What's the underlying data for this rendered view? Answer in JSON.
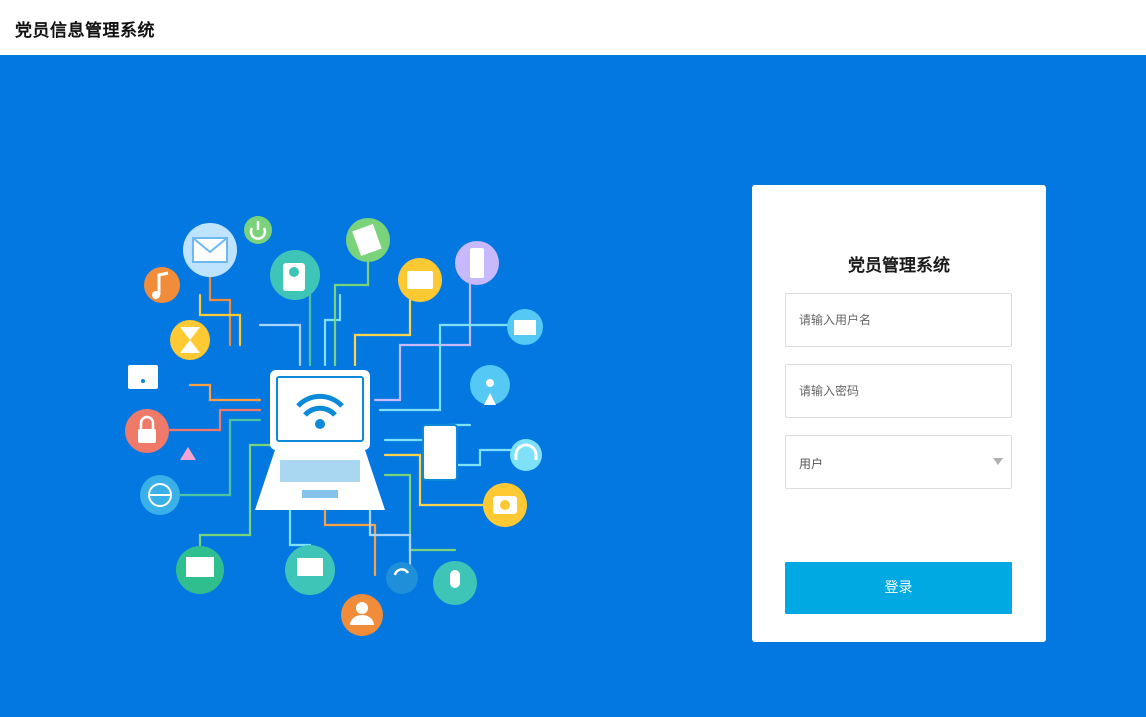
{
  "header": {
    "app_title": "党员信息管理系统"
  },
  "login": {
    "title": "党员管理系统",
    "username": {
      "placeholder": "请输入用户名",
      "value": ""
    },
    "password": {
      "placeholder": "请输入密码",
      "value": ""
    },
    "role": {
      "selected": "用户"
    },
    "submit_label": "登录"
  },
  "colors": {
    "background": "#0478e1",
    "button": "#00a9e2"
  },
  "illustration": {
    "icons": [
      "mail-icon",
      "power-icon",
      "camera-icon",
      "document-icon",
      "mobile-phone-icon",
      "music-note-icon",
      "hourglass-icon",
      "folder-icon",
      "wifi-monitor-icon",
      "lock-icon",
      "recycle-icon",
      "globe-icon",
      "laptop-icon",
      "tablet-icon",
      "antenna-icon",
      "headphones-icon",
      "photo-camera-icon",
      "microphone-icon",
      "sync-icon",
      "user-icon",
      "computer-icon"
    ]
  }
}
